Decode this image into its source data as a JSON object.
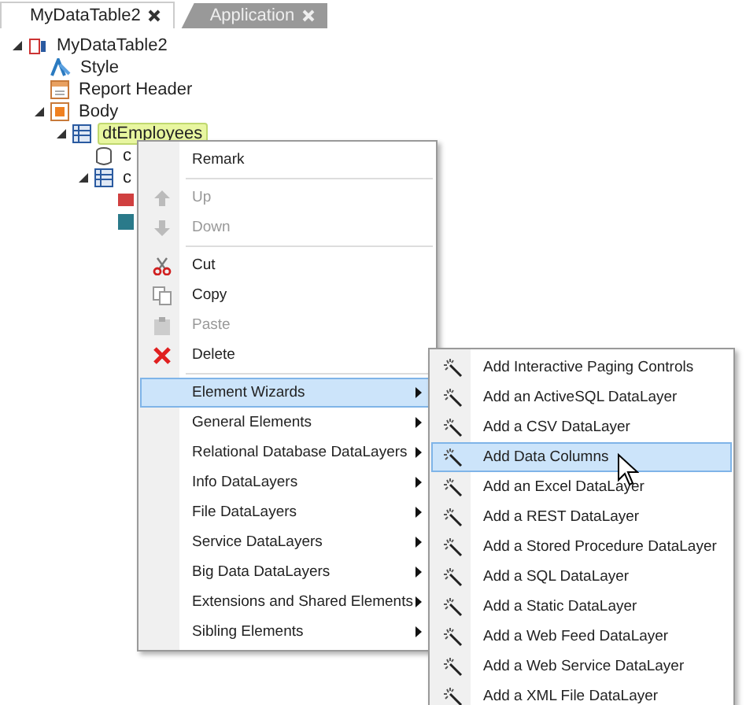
{
  "tabs": [
    {
      "label": "MyDataTable2",
      "selected": true
    },
    {
      "label": "Application",
      "selected": false
    }
  ],
  "tree": [
    {
      "kind": "report",
      "label": "MyDataTable2",
      "expanded": true,
      "selected": false,
      "children": [
        {
          "kind": "style",
          "label": "Style",
          "selected": false
        },
        {
          "kind": "header",
          "label": "Report Header",
          "selected": false
        },
        {
          "kind": "body",
          "label": "Body",
          "expanded": true,
          "selected": false,
          "children": [
            {
              "kind": "table",
              "label": "dtEmployees",
              "expanded": true,
              "selected": true,
              "children": [
                {
                  "kind": "database",
                  "label": "c",
                  "selected": false
                },
                {
                  "kind": "table",
                  "label": "c",
                  "expanded": true,
                  "selected": false,
                  "children": [
                    {
                      "kind": "filter"
                    },
                    {
                      "kind": "column"
                    }
                  ]
                }
              ]
            }
          ]
        }
      ]
    }
  ],
  "context_menu": {
    "groups": [
      [
        {
          "label": "Remark",
          "disabled": false,
          "selected": false,
          "submenu": false
        }
      ],
      [
        {
          "label": "Up",
          "disabled": true,
          "selected": false,
          "submenu": false
        },
        {
          "label": "Down",
          "disabled": true,
          "selected": false,
          "submenu": false
        }
      ],
      [
        {
          "label": "Cut",
          "disabled": false,
          "selected": false,
          "submenu": false
        },
        {
          "label": "Copy",
          "disabled": false,
          "selected": false,
          "submenu": false
        },
        {
          "label": "Paste",
          "disabled": true,
          "selected": false,
          "submenu": false
        },
        {
          "label": "Delete",
          "disabled": false,
          "selected": false,
          "submenu": false
        }
      ],
      [
        {
          "label": "Element Wizards",
          "disabled": false,
          "selected": true,
          "submenu": true
        },
        {
          "label": "General Elements",
          "disabled": false,
          "selected": false,
          "submenu": true
        },
        {
          "label": "Relational Database DataLayers",
          "disabled": false,
          "selected": false,
          "submenu": true
        },
        {
          "label": "Info DataLayers",
          "disabled": false,
          "selected": false,
          "submenu": true
        },
        {
          "label": "File DataLayers",
          "disabled": false,
          "selected": false,
          "submenu": true
        },
        {
          "label": "Service DataLayers",
          "disabled": false,
          "selected": false,
          "submenu": true
        },
        {
          "label": "Big Data DataLayers",
          "disabled": false,
          "selected": false,
          "submenu": true
        },
        {
          "label": "Extensions and Shared Elements",
          "disabled": false,
          "selected": false,
          "submenu": true
        },
        {
          "label": "Sibling Elements",
          "disabled": false,
          "selected": false,
          "submenu": true
        }
      ]
    ]
  },
  "submenu": {
    "items": [
      {
        "label": "Add Interactive Paging Controls",
        "selected": false
      },
      {
        "label": "Add an ActiveSQL DataLayer",
        "selected": false
      },
      {
        "label": "Add a CSV DataLayer",
        "selected": false
      },
      {
        "label": "Add Data Columns",
        "selected": true
      },
      {
        "label": "Add an Excel DataLayer",
        "selected": false
      },
      {
        "label": "Add a REST DataLayer",
        "selected": false
      },
      {
        "label": "Add a Stored Procedure DataLayer",
        "selected": false
      },
      {
        "label": "Add a SQL DataLayer",
        "selected": false
      },
      {
        "label": "Add a Static DataLayer",
        "selected": false
      },
      {
        "label": "Add a Web Feed DataLayer",
        "selected": false
      },
      {
        "label": "Add a Web Service DataLayer",
        "selected": false
      },
      {
        "label": "Add a XML File DataLayer",
        "selected": false
      }
    ]
  }
}
